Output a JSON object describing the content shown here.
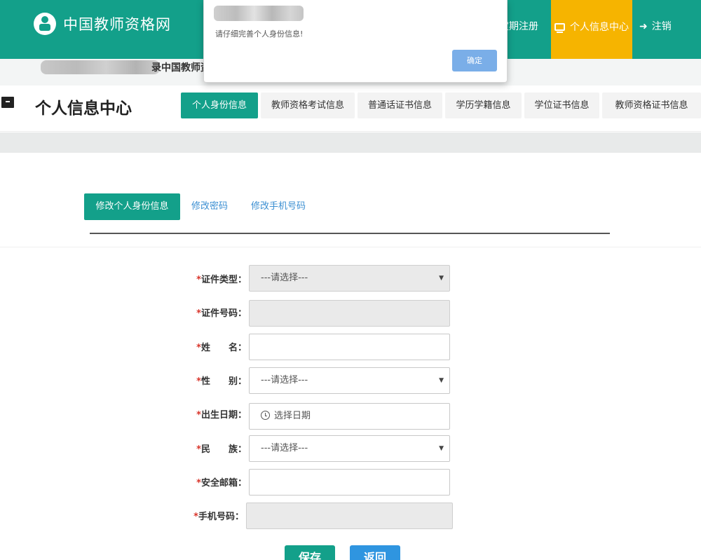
{
  "header": {
    "site_name": "中国教师资格网",
    "nav_register": "定期注册",
    "nav_info_center": "个人信息中心",
    "nav_logout": "注销",
    "accent_color": "#13a08a",
    "highlight_color": "#f6b400"
  },
  "breadcrumb": {
    "visible_text": "录中国教师资"
  },
  "page": {
    "title": "个人信息中心",
    "tabs": [
      {
        "label": "个人身份信息",
        "active": true
      },
      {
        "label": "教师资格考试信息"
      },
      {
        "label": "普通话证书信息"
      },
      {
        "label": "学历学籍信息"
      },
      {
        "label": "学位证书信息"
      },
      {
        "label": "教师资格证书信息"
      }
    ]
  },
  "subtabs": [
    {
      "label": "修改个人身份信息",
      "active": true
    },
    {
      "label": "修改密码"
    },
    {
      "label": "修改手机号码"
    }
  ],
  "form": {
    "star": "*",
    "fields": [
      {
        "label": "证件类型：",
        "type": "select",
        "value": "---请选择---"
      },
      {
        "label": "证件号码：",
        "type": "text-disabled",
        "value": ""
      },
      {
        "label": "姓　　名：",
        "type": "text",
        "value": ""
      },
      {
        "label": "性　　别：",
        "type": "select",
        "value": "---请选择---"
      },
      {
        "label": "出生日期：",
        "type": "date",
        "placeholder": "选择日期"
      },
      {
        "label": "民　　族：",
        "type": "select",
        "value": "---请选择---"
      },
      {
        "label": "安全邮箱：",
        "type": "text",
        "value": ""
      },
      {
        "label": "手机号码：",
        "type": "text-disabled",
        "value": ""
      }
    ],
    "save_label": "保存",
    "back_label": "返回"
  },
  "dialog": {
    "message": "请仔细完善个人身份信息!",
    "ok_label": "确定"
  },
  "icons": {
    "caret": "▼",
    "logout": "➜"
  }
}
